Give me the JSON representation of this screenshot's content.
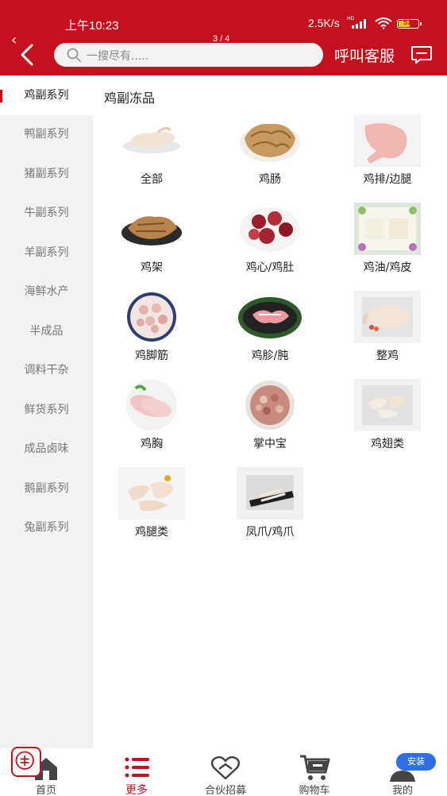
{
  "status": {
    "time": "上午10:23",
    "network": "2.5K/s",
    "hd": "HD",
    "battery": "57"
  },
  "header": {
    "page_indicator": "3 / 4",
    "search_placeholder": "一搜尽有.....",
    "service_label": "呼叫客服"
  },
  "sidebar": {
    "items": [
      {
        "label": "鸡副系列",
        "active": true
      },
      {
        "label": "鸭副系列"
      },
      {
        "label": "猪副系列"
      },
      {
        "label": "牛副系列"
      },
      {
        "label": "羊副系列"
      },
      {
        "label": "海鲜水产"
      },
      {
        "label": "半成品"
      },
      {
        "label": "调料干杂"
      },
      {
        "label": "鲜货系列"
      },
      {
        "label": "成品卤味"
      },
      {
        "label": "鹅副系列"
      },
      {
        "label": "兔副系列"
      }
    ]
  },
  "content": {
    "title": "鸡副冻品",
    "items": [
      {
        "label": "全部",
        "icon": "whole-chicken-plate-icon"
      },
      {
        "label": "鸡肠",
        "icon": "chicken-intestine-icon"
      },
      {
        "label": "鸡排/边腿",
        "icon": "chicken-leg-icon"
      },
      {
        "label": "鸡架",
        "icon": "chicken-frame-icon"
      },
      {
        "label": "鸡心/鸡肚",
        "icon": "chicken-heart-icon"
      },
      {
        "label": "鸡油/鸡皮",
        "icon": "chicken-skin-icon"
      },
      {
        "label": "鸡脚筋",
        "icon": "chicken-tendon-icon"
      },
      {
        "label": "鸡胗/肫",
        "icon": "chicken-gizzard-icon"
      },
      {
        "label": "整鸡",
        "icon": "whole-chicken-icon"
      },
      {
        "label": "鸡胸",
        "icon": "chicken-breast-icon"
      },
      {
        "label": "掌中宝",
        "icon": "chicken-cartilage-icon"
      },
      {
        "label": "鸡翅类",
        "icon": "chicken-wing-icon"
      },
      {
        "label": "鸡腿类",
        "icon": "chicken-drumstick-icon"
      },
      {
        "label": "凤爪/鸡爪",
        "icon": "chicken-feet-icon"
      }
    ]
  },
  "bottom_nav": {
    "items": [
      {
        "label": "首页",
        "icon": "home-icon"
      },
      {
        "label": "更多",
        "icon": "list-icon",
        "active": true
      },
      {
        "label": "合伙招募",
        "icon": "handshake-heart-icon"
      },
      {
        "label": "购物车",
        "icon": "cart-icon"
      },
      {
        "label": "我的",
        "icon": "user-icon"
      }
    ],
    "install_label": "安装"
  },
  "colors": {
    "brand": "#c5111d",
    "sidebar_bg": "#f2f2f2",
    "install": "#2f6fe6"
  }
}
